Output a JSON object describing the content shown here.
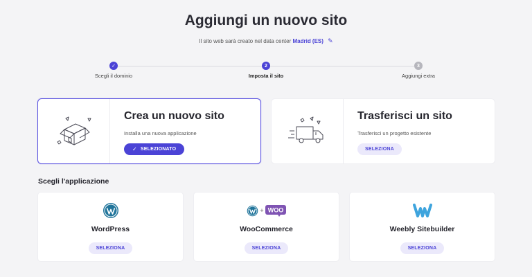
{
  "page": {
    "title": "Aggiungi un nuovo sito",
    "subtitle_prefix": "Il sito web sarà creato nel data center",
    "data_center": "Madrid (ES)"
  },
  "stepper": {
    "steps": [
      {
        "number": "1",
        "label": "Scegli il dominio",
        "state": "done"
      },
      {
        "number": "2",
        "label": "Imposta il sito",
        "state": "active"
      },
      {
        "number": "3",
        "label": "Aggiungi extra",
        "state": "pending"
      }
    ]
  },
  "options": [
    {
      "title": "Crea un nuovo sito",
      "description": "Installa una nuova applicazione",
      "button": "SELEZIONATO",
      "selected": true,
      "icon": "house-box-icon"
    },
    {
      "title": "Trasferisci un sito",
      "description": "Trasferisci un progetto esistente",
      "button": "SELEZIONA",
      "selected": false,
      "icon": "truck-icon"
    }
  ],
  "apps_section": {
    "heading": "Scegli l'applicazione",
    "apps": [
      {
        "name": "WordPress",
        "button": "SELEZIONA",
        "icon": "wordpress-icon"
      },
      {
        "name": "WooCommerce",
        "button": "SELEZIONA",
        "icon": "woocommerce-icon",
        "logo_text": "WOO"
      },
      {
        "name": "Weebly Sitebuilder",
        "button": "SELEZIONA",
        "icon": "weebly-icon"
      }
    ]
  },
  "colors": {
    "accent": "#4b43d6",
    "accent_light": "#ebe9fb",
    "background": "#f4f4f6",
    "woo_purple": "#7f54b3",
    "weebly_blue": "#3ea4dd"
  }
}
